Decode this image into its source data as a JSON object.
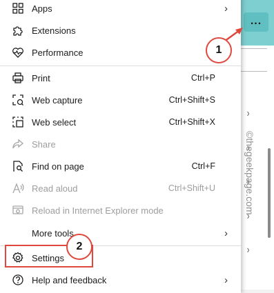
{
  "background": {
    "more_button_label": "...",
    "watermark": "©thegeekpage.com",
    "chevron": "›"
  },
  "menu": {
    "items": [
      {
        "label": "Apps",
        "shortcut": "",
        "icon": "apps-icon",
        "submenu": true,
        "disabled": false
      },
      {
        "label": "Extensions",
        "shortcut": "",
        "icon": "extensions-icon",
        "submenu": false,
        "disabled": false
      },
      {
        "label": "Performance",
        "shortcut": "",
        "icon": "performance-icon",
        "submenu": false,
        "disabled": false
      },
      {
        "label": "Print",
        "shortcut": "Ctrl+P",
        "icon": "print-icon",
        "submenu": false,
        "disabled": false
      },
      {
        "label": "Web capture",
        "shortcut": "Ctrl+Shift+S",
        "icon": "web-capture-icon",
        "submenu": false,
        "disabled": false
      },
      {
        "label": "Web select",
        "shortcut": "Ctrl+Shift+X",
        "icon": "web-select-icon",
        "submenu": false,
        "disabled": false
      },
      {
        "label": "Share",
        "shortcut": "",
        "icon": "share-icon",
        "submenu": false,
        "disabled": true
      },
      {
        "label": "Find on page",
        "shortcut": "Ctrl+F",
        "icon": "find-icon",
        "submenu": false,
        "disabled": false
      },
      {
        "label": "Read aloud",
        "shortcut": "Ctrl+Shift+U",
        "icon": "read-aloud-icon",
        "submenu": false,
        "disabled": true
      },
      {
        "label": "Reload in Internet Explorer mode",
        "shortcut": "",
        "icon": "ie-mode-icon",
        "submenu": false,
        "disabled": true
      },
      {
        "label": "More tools",
        "shortcut": "",
        "icon": "",
        "submenu": true,
        "disabled": false
      },
      {
        "label": "Settings",
        "shortcut": "",
        "icon": "gear-icon",
        "submenu": false,
        "disabled": false
      },
      {
        "label": "Help and feedback",
        "shortcut": "",
        "icon": "help-icon",
        "submenu": true,
        "disabled": false
      }
    ],
    "submenu_arrow": "›"
  },
  "annotations": {
    "callout_1": "1",
    "callout_2": "2",
    "accent_color": "#e0483e"
  }
}
